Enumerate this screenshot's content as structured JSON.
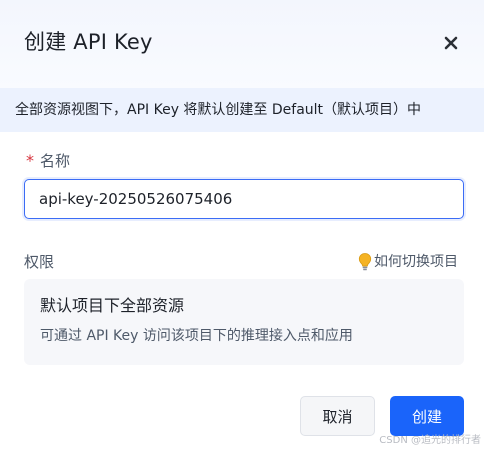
{
  "dialog": {
    "title": "创建 API Key",
    "close_icon": "close-icon"
  },
  "banner": {
    "text": "全部资源视图下，API Key 将默认创建至 Default（默认项目）中"
  },
  "name_field": {
    "required_mark": "*",
    "label": "名称",
    "value": "api-key-20250526075406"
  },
  "permission": {
    "label": "权限",
    "help_icon": "lightbulb-icon",
    "help_link": "如何切换项目",
    "card_title": "默认项目下全部资源",
    "card_desc": "可通过 API Key 访问该项目下的推理接入点和应用"
  },
  "footer": {
    "cancel_label": "取消",
    "create_label": "创建"
  },
  "watermark": "CSDN @追光的排行者",
  "colors": {
    "primary": "#1a64fa",
    "banner_bg": "#ecf2fe",
    "required": "#d7343e",
    "bulb": "#f5b324"
  }
}
